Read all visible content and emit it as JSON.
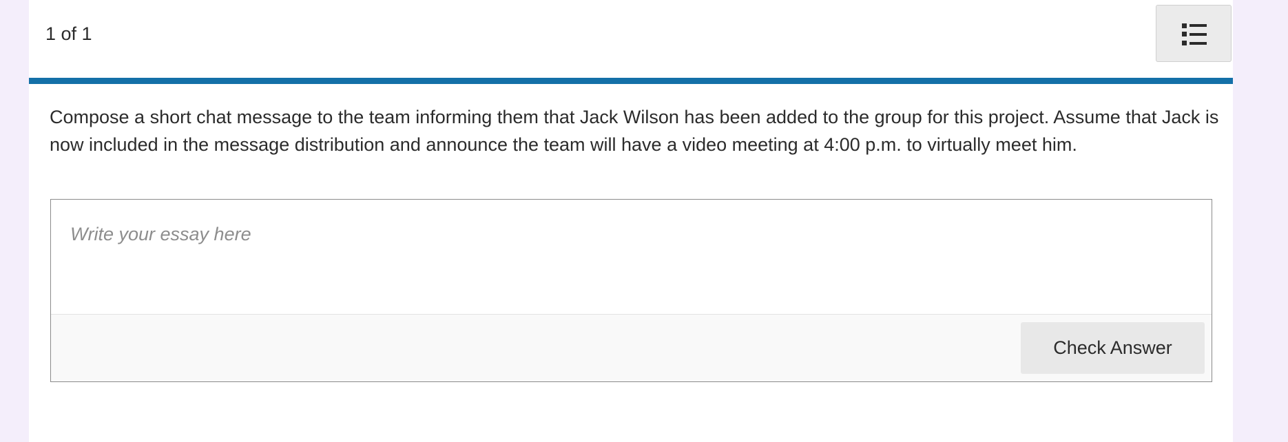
{
  "header": {
    "counter": "1 of 1",
    "menu_icon": "list-icon"
  },
  "colors": {
    "accent": "#1470a8",
    "page_background": "#f4eefb",
    "panel_background": "#ffffff"
  },
  "question": {
    "prompt": "Compose a short chat message to the team informing them that Jack Wilson has been added to the group for this project. Assume that Jack is now included in the message distribution and announce the team will have a video meeting at 4:00 p.m. to virtually meet him."
  },
  "essay": {
    "value": "",
    "placeholder": "Write your essay here"
  },
  "actions": {
    "check_label": "Check Answer"
  }
}
